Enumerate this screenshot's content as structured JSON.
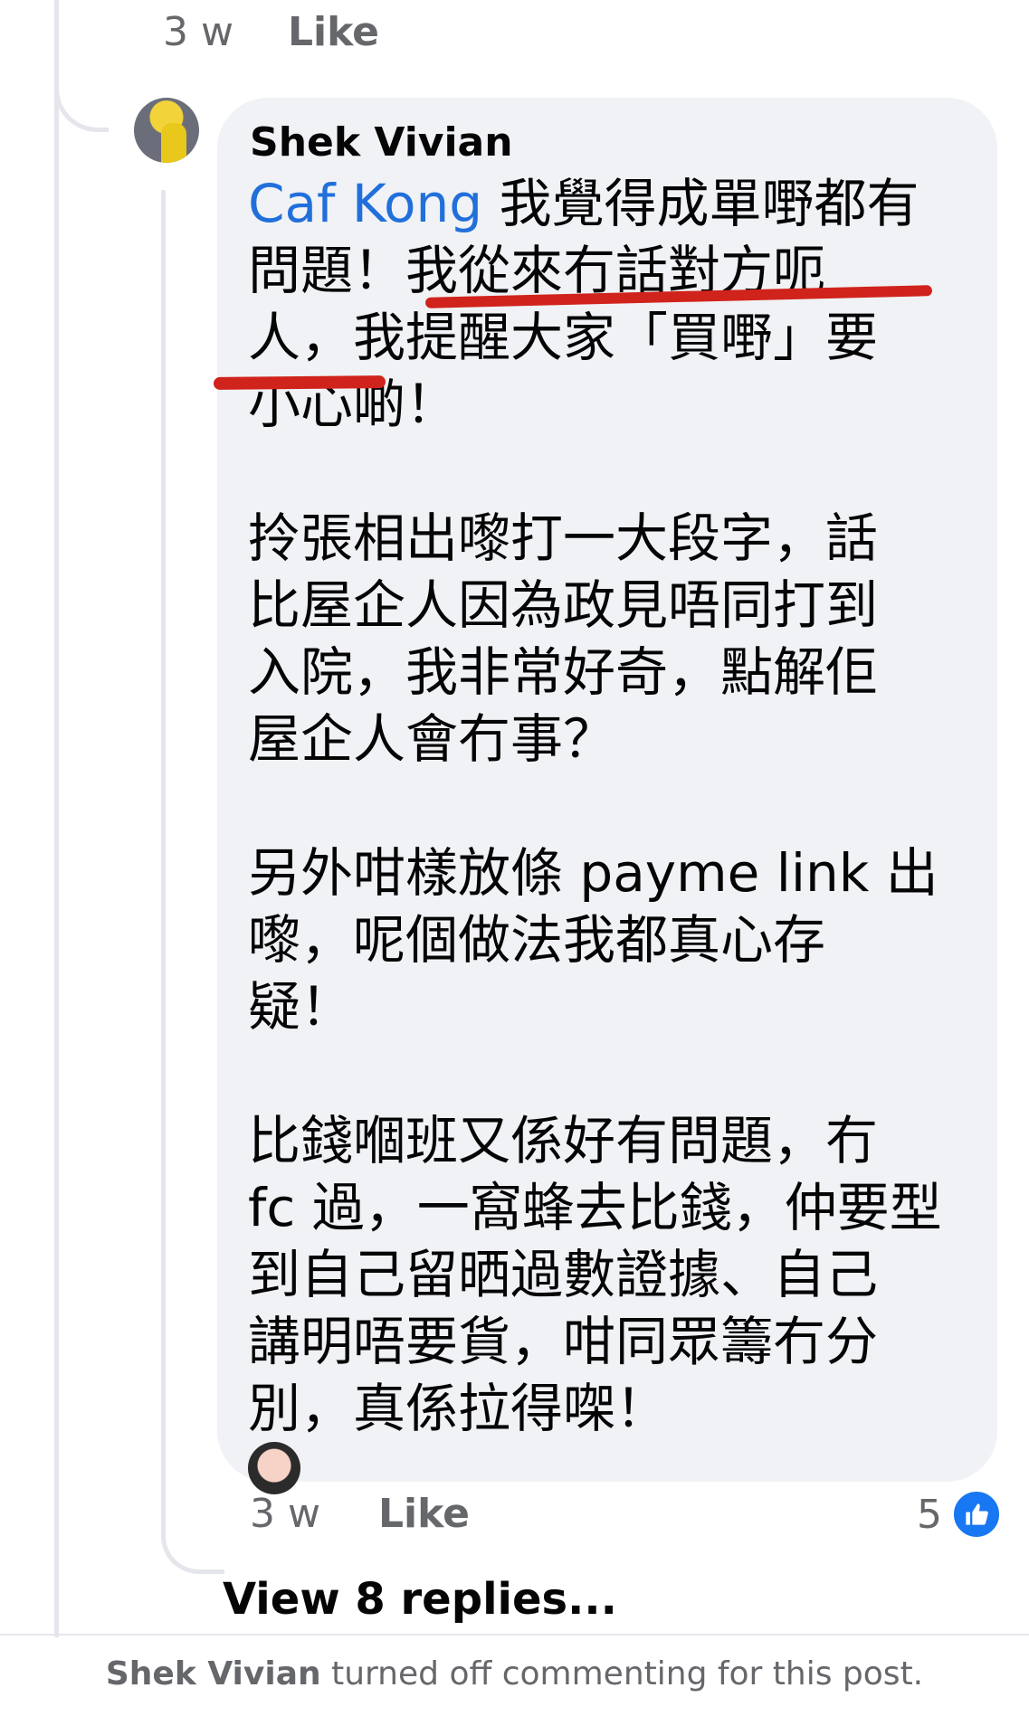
{
  "top_meta": {
    "time": "3 w",
    "like": "Like"
  },
  "comment": {
    "author": "Shek Vivian",
    "mention": "Caf Kong",
    "paragraphs": [
      [
        "我覺得成單嘢都有",
        "問題！我從來冇話對方呃",
        "人，我提醒大家「買嘢」要",
        "小心啲！"
      ],
      [
        "拎張相出嚟打一大段字，話",
        "比屋企人因為政見唔同打到",
        "入院，我非常好奇，點解佢",
        "屋企人會冇事？"
      ],
      [
        "另外咁樣放條 payme link 出",
        "嚟，呢個做法我都真心存",
        "疑！"
      ],
      [
        "比錢嗰班又係好有問題，冇",
        "fc 過，一窩蜂去比錢，仲要型",
        "到自己留晒過數證據、自己",
        "講明唔要貨，咁同眾籌冇分",
        "別，真係拉得㗎！"
      ]
    ],
    "time": "3 w",
    "like": "Like",
    "reaction_count": "5"
  },
  "view_replies": "View 8 replies...",
  "footer": {
    "name": "Shek Vivian",
    "text": "turned off commenting for this post."
  }
}
